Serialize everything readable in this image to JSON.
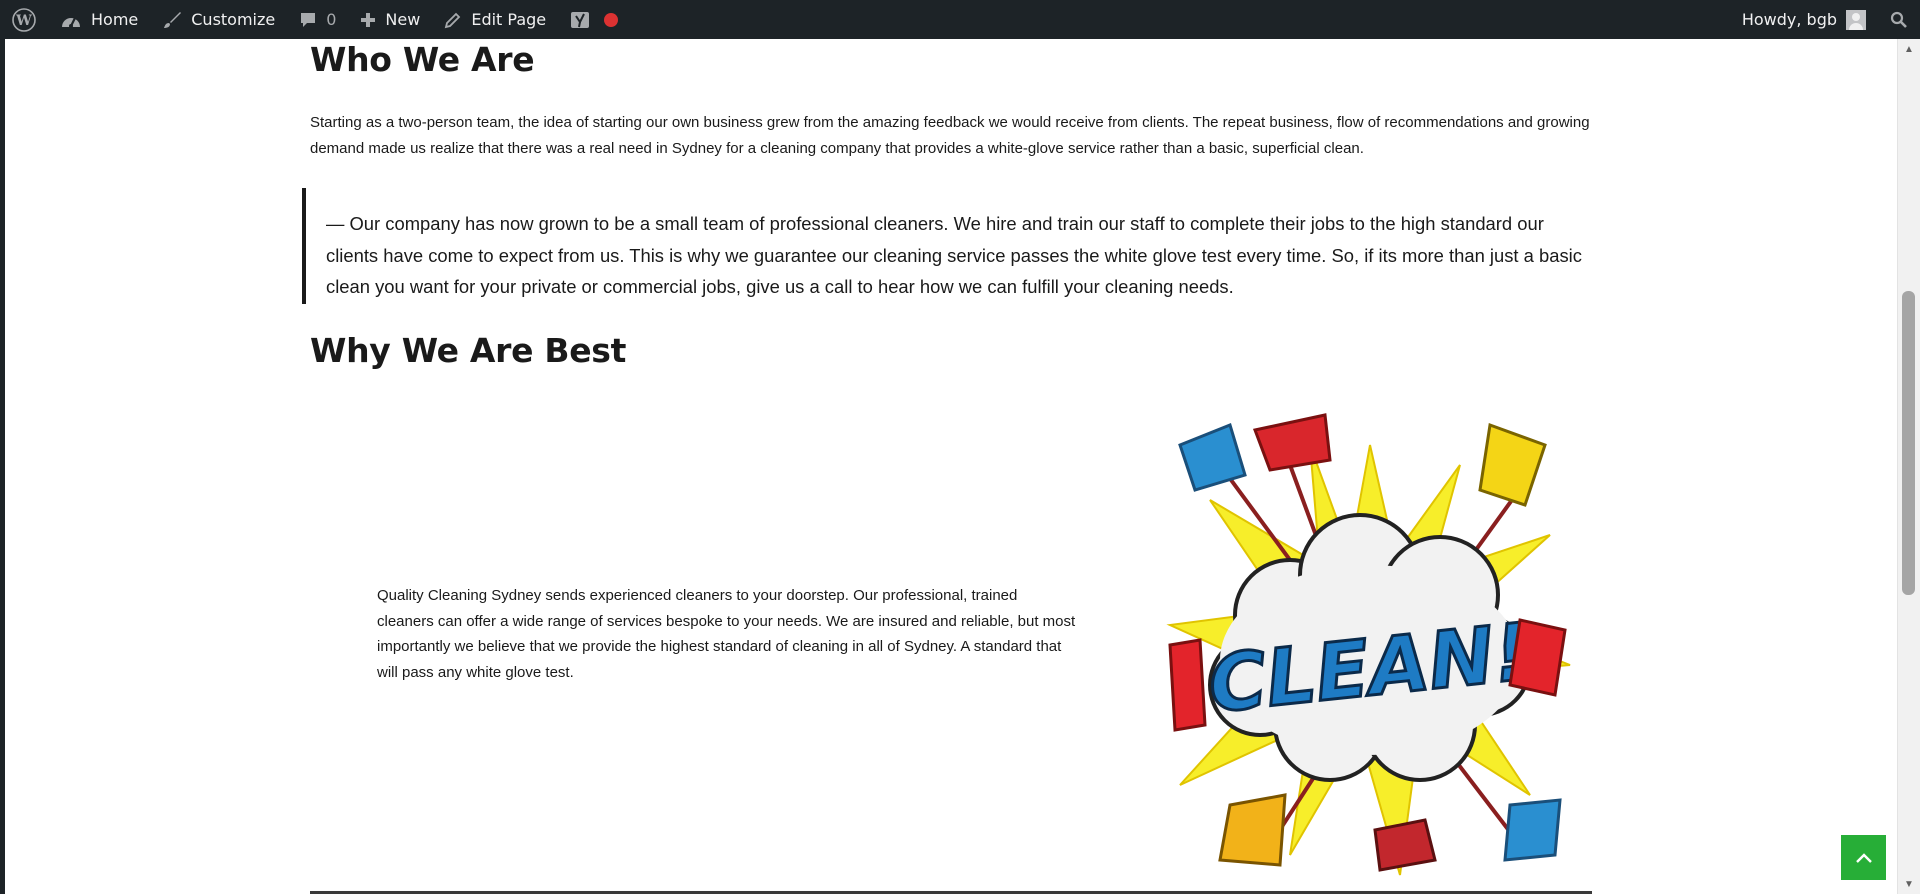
{
  "adminbar": {
    "wp_logo": "wordpress-icon",
    "home_label": "Home",
    "customize_label": "Customize",
    "comments_count": "0",
    "new_label": "New",
    "edit_label": "Edit Page",
    "greeting": "Howdy, bgb",
    "colors": {
      "background": "#1d2327",
      "text": "#f0f0f1",
      "record": "#dc3232"
    }
  },
  "page": {
    "who_heading": "Who We Are",
    "intro_text": "Starting as a two-person team, the idea of starting our own business grew from the amazing feedback we would receive from clients.  The repeat business, flow of recommendations and growing demand made us realize that there was a real need in Sydney for a cleaning company that provides a white-glove service rather than a basic, superficial clean.",
    "quote_text": "— Our company has now grown to be a small team of professional cleaners.  We hire and train our staff to complete their jobs to the high standard our clients have come to expect from us.  This is why we guarantee our cleaning service passes the white glove test every time. So, if its more than just a basic clean you want for your private or commercial jobs, give us a call to hear how we can fulfill your cleaning needs.",
    "why_heading": "Why We Are Best",
    "quality_text": "Quality Cleaning Sydney sends experienced cleaners to your doorstep. Our professional, trained cleaners can offer a wide range of services bespoke to your needs. We are insured and reliable, but most importantly we believe that we provide the highest standard of cleaning in all of Sydney.  A standard that will pass any white glove test.",
    "clean_image_text": "CLEAN!"
  },
  "back_to_top": {
    "icon": "chevron-up-icon",
    "color": "#27ae37"
  }
}
